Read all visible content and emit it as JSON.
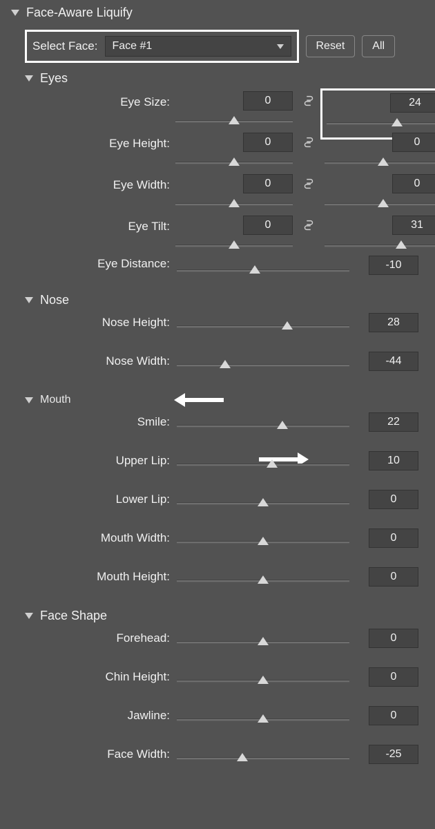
{
  "title": "Face-Aware Liquify",
  "selectFace": {
    "label": "Select Face:",
    "value": "Face #1"
  },
  "buttons": {
    "reset": "Reset",
    "all": "All"
  },
  "sections": {
    "eyes": {
      "title": "Eyes"
    },
    "nose": {
      "title": "Nose"
    },
    "mouth": {
      "title": "Mouth"
    },
    "shape": {
      "title": "Face Shape"
    }
  },
  "eyes": {
    "size": {
      "label": "Eye Size:",
      "left": "0",
      "right": "24",
      "lpos": 50,
      "rpos": 62
    },
    "height": {
      "label": "Eye Height:",
      "left": "0",
      "right": "0",
      "lpos": 50,
      "rpos": 50
    },
    "width": {
      "label": "Eye Width:",
      "left": "0",
      "right": "0",
      "lpos": 50,
      "rpos": 50
    },
    "tilt": {
      "label": "Eye Tilt:",
      "left": "0",
      "right": "31",
      "lpos": 50,
      "rpos": 65
    },
    "distance": {
      "label": "Eye Distance:",
      "value": "-10",
      "pos": 45
    }
  },
  "nose": {
    "height": {
      "label": "Nose Height:",
      "value": "28",
      "pos": 64
    },
    "width": {
      "label": "Nose Width:",
      "value": "-44",
      "pos": 28
    }
  },
  "mouth": {
    "smile": {
      "label": "Smile:",
      "value": "22",
      "pos": 61
    },
    "upperLip": {
      "label": "Upper Lip:",
      "value": "10",
      "pos": 55
    },
    "lowerLip": {
      "label": "Lower Lip:",
      "value": "0",
      "pos": 50
    },
    "mouthWidth": {
      "label": "Mouth Width:",
      "value": "0",
      "pos": 50
    },
    "mouthHeight": {
      "label": "Mouth Height:",
      "value": "0",
      "pos": 50
    }
  },
  "shape": {
    "forehead": {
      "label": "Forehead:",
      "value": "0",
      "pos": 50
    },
    "chinHeight": {
      "label": "Chin Height:",
      "value": "0",
      "pos": 50
    },
    "jawline": {
      "label": "Jawline:",
      "value": "0",
      "pos": 50
    },
    "faceWidth": {
      "label": "Face Width:",
      "value": "-25",
      "pos": 38
    }
  }
}
